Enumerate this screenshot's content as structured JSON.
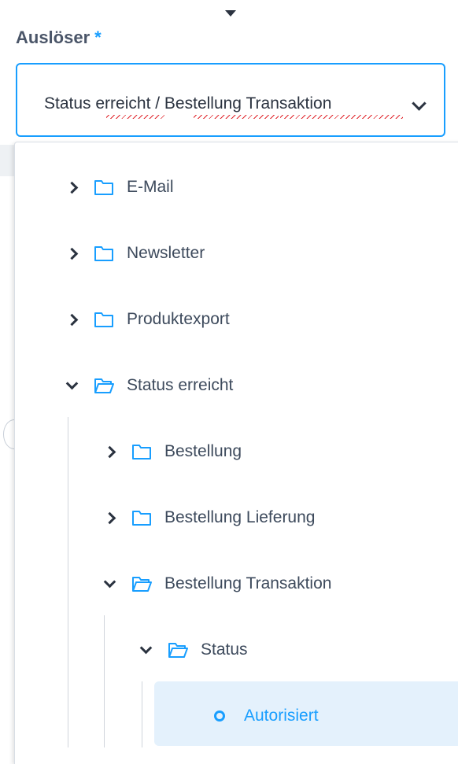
{
  "field": {
    "label": "Auslöser",
    "required_marker": "*",
    "value_parts": [
      "Status ",
      "erreicht",
      " / ",
      "Bestellung",
      " ",
      "Transaktion"
    ]
  },
  "tree": {
    "items": [
      {
        "label": "E-Mail",
        "expanded": false
      },
      {
        "label": "Newsletter",
        "expanded": false
      },
      {
        "label": "Produktexport",
        "expanded": false
      },
      {
        "label": "Status erreicht",
        "expanded": true
      },
      {
        "label": "Bestellung",
        "expanded": false
      },
      {
        "label": "Bestellung Lieferung",
        "expanded": false
      },
      {
        "label": "Bestellung Transaktion",
        "expanded": true
      },
      {
        "label": "Status",
        "expanded": true
      }
    ],
    "selected_leaf": "Autorisiert"
  },
  "colors": {
    "accent": "#189eff",
    "selected_bg": "#e4f1fc",
    "spell_error": "#e0242a"
  }
}
